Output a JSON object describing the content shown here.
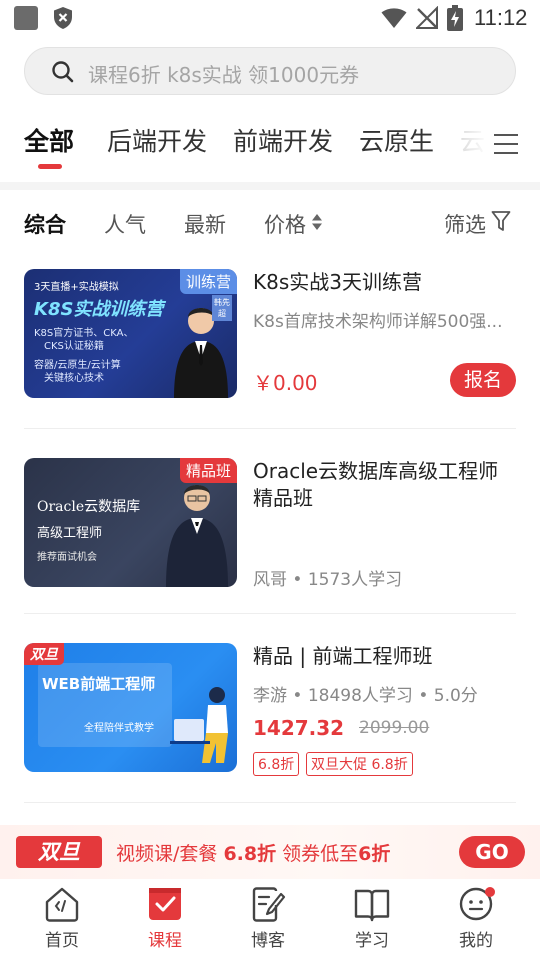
{
  "status_bar": {
    "time": "11:12"
  },
  "search": {
    "placeholder": "课程6折 k8s实战 领1000元券"
  },
  "categories": [
    "全部",
    "后端开发",
    "前端开发",
    "云原生",
    "云"
  ],
  "sort": {
    "items": [
      "综合",
      "人气",
      "最新",
      "价格"
    ],
    "filter_label": "筛选"
  },
  "courses": [
    {
      "title": "K8s实战3天训练营",
      "subtitle": "K8s首席技术架构师详解500强...",
      "price": "￥0.00",
      "button": "报名",
      "badge": "训练营",
      "thumb": {
        "top": "3天直播+实战模拟",
        "heading": "K8S实战训练营",
        "line1": "K8S官方证书、CKA、",
        "line2": "CKS认证秘籍",
        "line3": "容器/云原生/云计算",
        "line4": "关键核心技术",
        "teacher_tag": "韩先超"
      }
    },
    {
      "title": "Oracle云数据库高级工程师精品班",
      "meta": "风哥 • 1573人学习",
      "badge": "精品班",
      "thumb": {
        "line1": "Oracle云数据库",
        "line2": "高级工程师",
        "line3": "推荐面试机会"
      }
    },
    {
      "title": "精品 | 前端工程师班",
      "meta": "李游 • 18498人学习 • 5.0分",
      "price": "1427.32",
      "old_price": "2099.00",
      "tags": [
        "6.8折",
        "双旦大促 6.8折"
      ],
      "badge": "双旦",
      "thumb": {
        "heading": "WEB前端工程师",
        "line1": "全程陪伴式教学"
      }
    }
  ],
  "promo": {
    "logo": "双旦",
    "text_a": "视频课/套餐 ",
    "text_b": "6.8折",
    "text_c": " 领券低至",
    "text_d": "6折",
    "go": "GO"
  },
  "nav": [
    "首页",
    "课程",
    "博客",
    "学习",
    "我的"
  ],
  "colors": {
    "accent": "#e4393c"
  }
}
